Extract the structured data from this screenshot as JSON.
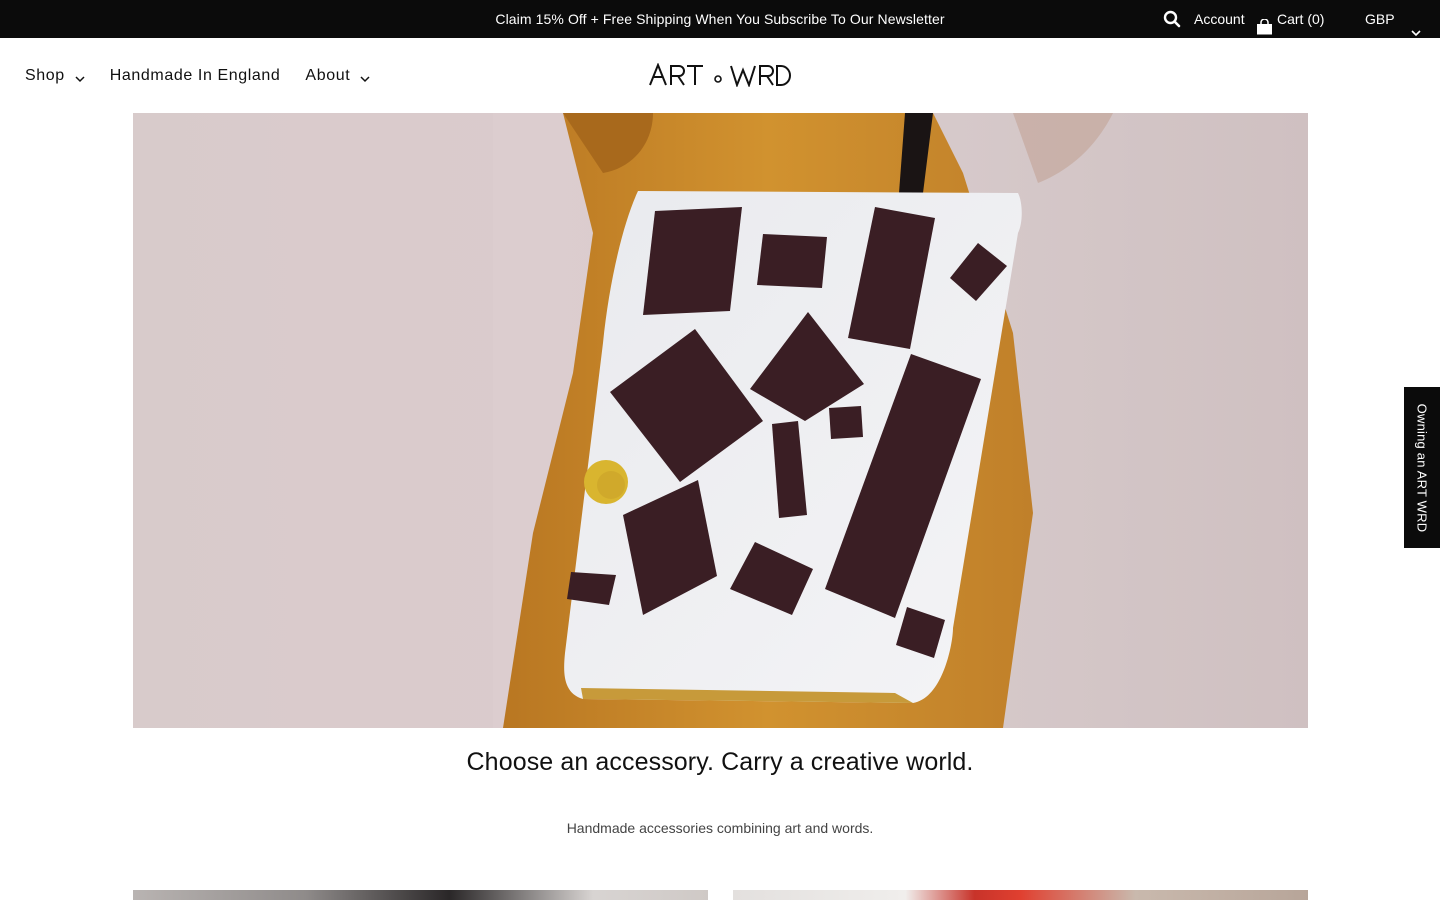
{
  "announcement": {
    "text": "Claim 15% Off + Free Shipping When You Subscribe To Our Newsletter"
  },
  "utility": {
    "search_icon": "search-icon",
    "account_label": "Account",
    "cart_label": "Cart (0)",
    "currency_label": "GBP"
  },
  "nav": {
    "items": [
      {
        "label": "Shop",
        "has_dropdown": true
      },
      {
        "label": "Handmade In England",
        "has_dropdown": false
      },
      {
        "label": "About",
        "has_dropdown": true
      }
    ]
  },
  "logo": {
    "text": "ART o WRD"
  },
  "hero": {
    "tagline": "Choose an accessory. Carry a creative world.",
    "subline": "Handmade accessories combining art and words."
  },
  "side_tab": {
    "label": "Owning an ART WRD"
  },
  "colors": {
    "bar_bg": "#0b0b0b",
    "text": "#111111",
    "bag_print": "#3a1e24",
    "coat": "#c9892e",
    "wall": "#d9cfd0"
  }
}
